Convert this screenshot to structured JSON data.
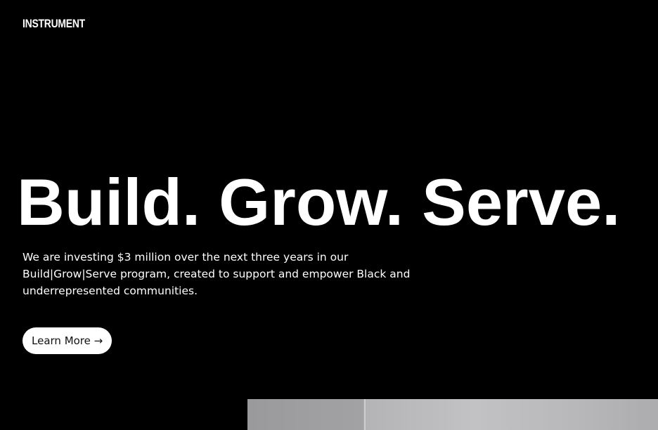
{
  "header": {
    "logo_text": "INSTRUMENT"
  },
  "hero": {
    "title": "Build. Grow. Serve.",
    "description": "We are investing $3 million over the next three years in our Build|Grow|Serve program, created to support and empower Black and underrepresented communities.",
    "cta_label": "Learn More →"
  },
  "colors": {
    "background": "#000000",
    "text": "#ffffff",
    "button_background": "#ffffff",
    "button_text": "#111111"
  }
}
